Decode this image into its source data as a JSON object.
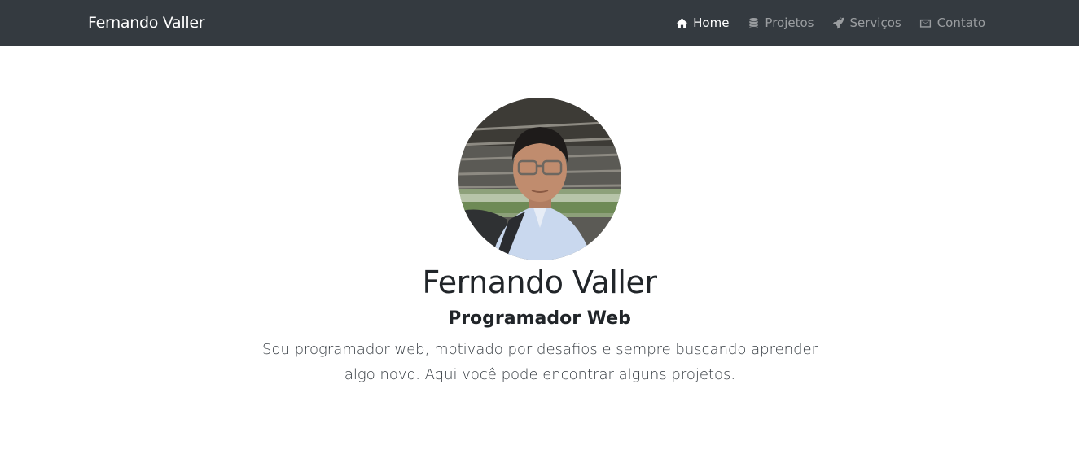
{
  "navbar": {
    "brand": "Fernando Valler",
    "items": [
      {
        "label": "Home",
        "icon": "home-icon",
        "active": true
      },
      {
        "label": "Projetos",
        "icon": "database-icon",
        "active": false
      },
      {
        "label": "Serviços",
        "icon": "rocket-icon",
        "active": false
      },
      {
        "label": "Contato",
        "icon": "envelope-icon",
        "active": false
      }
    ]
  },
  "hero": {
    "name": "Fernando Valler",
    "role": "Programador Web",
    "bio": "Sou programador web, motivado por desafios e sempre buscando aprender algo novo. Aqui você pode encontrar alguns projetos."
  },
  "colors": {
    "navbar_bg": "#343a40",
    "nav_active": "#ffffff",
    "nav_inactive": "rgba(255,255,255,0.5)",
    "text": "#212529"
  }
}
